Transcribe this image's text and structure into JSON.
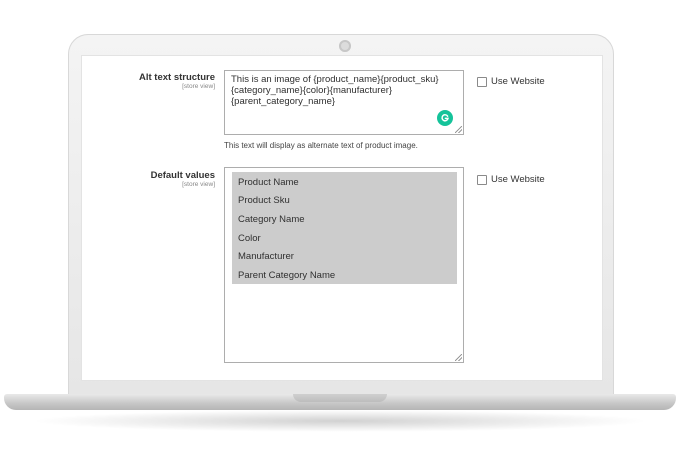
{
  "alt_text": {
    "label": "Alt text structure",
    "scope": "[store view]",
    "value_lines": [
      "This is an image of {product_name}{product_sku}",
      "{category_name}{color}{manufacturer}",
      "{parent_category_name}"
    ],
    "note": "This text will display as alternate text of product image.",
    "use_website_label": "Use Website"
  },
  "default_values": {
    "label": "Default values",
    "scope": "[store view]",
    "options": [
      "Product Name",
      "Product Sku",
      "Category Name",
      "Color",
      "Manufacturer",
      "Parent Category Name"
    ],
    "use_website_label": "Use Website"
  },
  "colors": {
    "grammarly": "#15c39a",
    "selected_option_bg": "#cccccc"
  },
  "icons": {
    "grammarly": "grammarly-icon"
  }
}
